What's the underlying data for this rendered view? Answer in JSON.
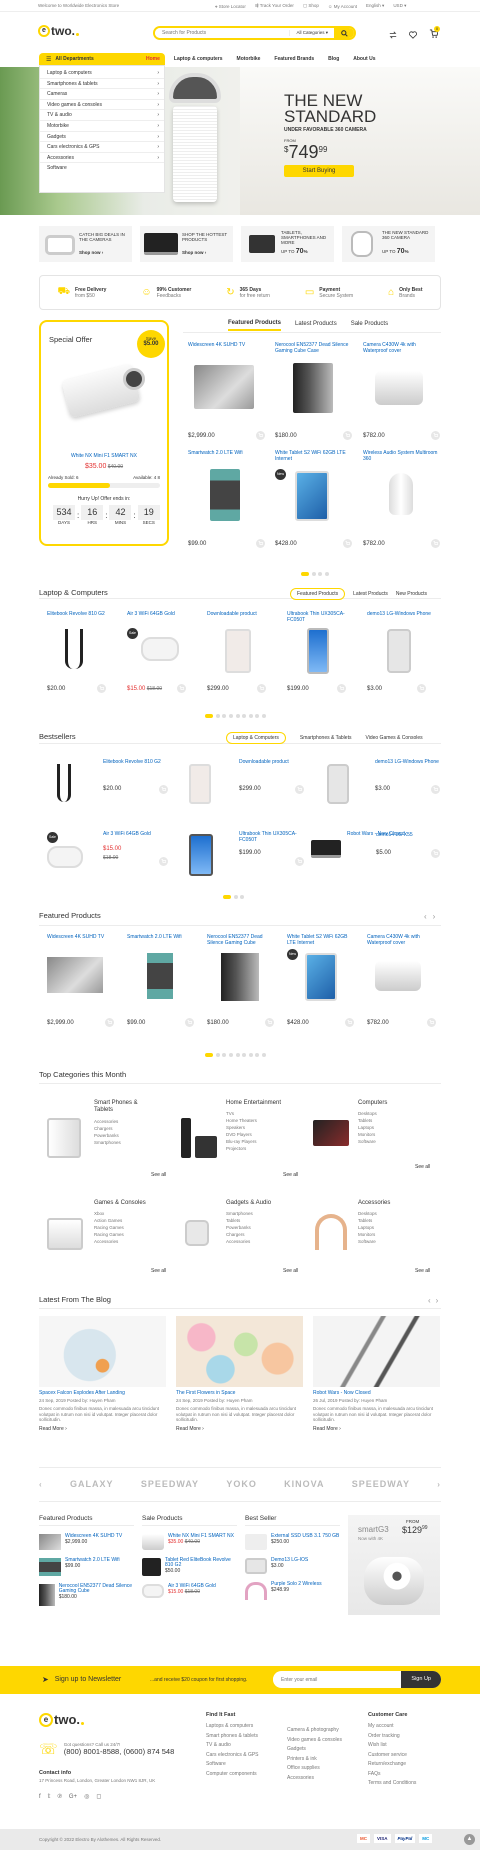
{
  "topbar": {
    "welcome": "Welcome to Worldwide Electronics Store",
    "links": [
      "Store Locator",
      "Track Your Order",
      "Shop",
      "My Account"
    ],
    "lang": "English",
    "currency": "USD"
  },
  "header": {
    "logo": "electro",
    "search_placeholder": "Search for Products",
    "category_select": "All Categories",
    "cart_count": "0"
  },
  "nav": [
    "Home",
    "Laptop & computers",
    "Motorbike",
    "Featured Brands",
    "Blog",
    "About Us"
  ],
  "sidebar": {
    "title": "All Departments",
    "items": [
      "Laptop & computers",
      "Smartphones & tablets",
      "Cameras",
      "Video games & consoles",
      "TV & audio",
      "Motorbike",
      "Gadgets",
      "Cars electronics & GPS",
      "Accessories",
      "Software"
    ]
  },
  "hero": {
    "line1": "THE NEW",
    "line2": "STANDARD",
    "sub": "UNDER FAVORABLE 360 CAMERA",
    "from": "FROM",
    "price": "749",
    "cents": "99",
    "cta": "Start Buying"
  },
  "promo_banners": [
    {
      "text": "CATCH BIG DEALS IN THE CAMERAS",
      "link": "Shop now"
    },
    {
      "text": "SHOP THE HOTTEST PRODUCTS",
      "link": "Shop now"
    },
    {
      "text": "TABLETS, SMARTPHONES AND MORE",
      "upto": "UP TO",
      "pct": "70"
    },
    {
      "text": "THE NEW STANDARD 360 CAMERA",
      "upto": "UP TO",
      "pct": "70"
    }
  ],
  "features": [
    {
      "title": "Free Delivery",
      "sub": "from $50"
    },
    {
      "title": "99% Customer",
      "sub": "Feedbacks"
    },
    {
      "title": "365 Days",
      "sub": "for free return"
    },
    {
      "title": "Payment",
      "sub": "Secure System"
    },
    {
      "title": "Only Best",
      "sub": "Brands"
    }
  ],
  "special_offer": {
    "title": "Special Offer",
    "save_label": "Save",
    "save_amount": "$5.00",
    "product": "White NX Mini F1 SMART NX",
    "price": "$35.00",
    "old_price": "$40.00",
    "sold_label": "Already Sold: 6",
    "available_label": "Available: 4 8",
    "timer_label": "Hurry Up! Offer ends in:",
    "timer": [
      {
        "v": "534",
        "l": "DAYS"
      },
      {
        "v": "16",
        "l": "HRS"
      },
      {
        "v": "42",
        "l": "MINS"
      },
      {
        "v": "19",
        "l": "SECS"
      }
    ]
  },
  "featured_tabs": [
    "Featured Products",
    "Latest Products",
    "Sale Products"
  ],
  "featured_grid": [
    {
      "name": "Widescreen 4K SUHD TV",
      "price": "$2,999.00"
    },
    {
      "name": "Nerocool EN52377 Dead Silence Gaming Cube Case",
      "price": "$180.00"
    },
    {
      "name": "Camera C430W 4k with Waterproof cover",
      "price": "$782.00"
    },
    {
      "name": "Smartwatch 2.0 LTE Wifi",
      "price": "$99.00"
    },
    {
      "name": "White Tablet S2 WiFi 62GB LTE Internet",
      "price": "$428.00",
      "badge": "New"
    },
    {
      "name": "Wireless Audio System Multiroom 360",
      "price": "$782.00"
    }
  ],
  "laptops_section": {
    "title": "Laptop & Computers",
    "tabs": [
      "Featured Products",
      "Latest Products",
      "New Products"
    ],
    "products": [
      {
        "name": "Elitebook Revolve 810 G2",
        "price": "$20.00"
      },
      {
        "name": "Air 3 WiFi 64GB Gold",
        "price": "$15.00",
        "old": "$18.00",
        "badge": "Sale"
      },
      {
        "name": "Downloadable product",
        "price": "$299.00"
      },
      {
        "name": "Ultrabook Thin UX305CA-FC050T",
        "price": "$199.00"
      },
      {
        "name": "demo13 LG-Windows Phone",
        "price": "$3.00"
      }
    ]
  },
  "bestsellers": {
    "title": "Bestsellers",
    "tabs": [
      "Laptop & Computers",
      "Smartphones & Tablets",
      "Video Games & Consoles"
    ],
    "products": [
      {
        "name": "Elitebook Revolve 810 G2",
        "price": "$20.00"
      },
      {
        "name": "Downloadable product",
        "price": "$299.00"
      },
      {
        "name": "demo13 LG-Windows Phone",
        "price": "$3.00"
      },
      {
        "name": "Air 3 WiFi 64GB Gold",
        "price": "$15.00",
        "old": "$18.00",
        "badge": "Sale"
      },
      {
        "name": "Ultrabook Thin UX305CA-FC050T",
        "price": "$199.00"
      },
      {
        "name": "Robot Wars - Now Closed",
        "price": "$5.00"
      },
      {
        "name": "demo14 LG-X55",
        "price": "$5.00"
      }
    ]
  },
  "featured_row": {
    "title": "Featured Products",
    "products": [
      {
        "name": "Widescreen 4K SUHD TV",
        "price": "$2,999.00"
      },
      {
        "name": "Smartwatch 2.0 LTE Wifi",
        "price": "$99.00"
      },
      {
        "name": "Nerocool EN52377 Dead Silence Gaming Cube",
        "price": "$180.00"
      },
      {
        "name": "White Tablet S2 WiFi 62GB LTE Internet",
        "price": "$428.00",
        "badge": "New"
      },
      {
        "name": "Camera C430W 4k with Waterproof cover",
        "price": "$782.00"
      }
    ]
  },
  "top_categories": {
    "title": "Top Categories this Month",
    "see_all": "See all",
    "items": [
      {
        "name": "Smart Phones & Tablets",
        "subs": [
          "Accessories",
          "Chargers",
          "Powerbanks",
          "Smartphones"
        ]
      },
      {
        "name": "Home Entertainment",
        "subs": [
          "TVs",
          "Home Theaters",
          "Speakers",
          "DVD Players",
          "Blu-ray Players",
          "Projectors"
        ]
      },
      {
        "name": "Computers",
        "subs": [
          "Desktops",
          "Tablets",
          "Laptops",
          "Monitors",
          "Software"
        ]
      },
      {
        "name": "Games & Consoles",
        "subs": [
          "Xbox",
          "Action Games",
          "Racing Games",
          "Racing Games",
          "Accessories"
        ]
      },
      {
        "name": "Gadgets & Audio",
        "subs": [
          "Smartphones",
          "Tablets",
          "Powerbanks",
          "Chargers",
          "Accessories"
        ]
      },
      {
        "name": "Accessories",
        "subs": [
          "Desktops",
          "Tablets",
          "Laptops",
          "Monitors",
          "Software"
        ]
      }
    ]
  },
  "blog": {
    "title": "Latest From The Blog",
    "read_more": "Read More",
    "excerpt": "Donec commodo finibus massa, in malesuada arcu tincidunt volutpat in rutrum non nisi id volutpat. Integer placerat dolor sollicitudin.",
    "posts": [
      {
        "title": "Spacex Falcon Explodes After Landing",
        "meta": "24 Sep, 2019  Posted by: Huyen Pham"
      },
      {
        "title": "The First Flowers in Space",
        "meta": "24 Sep, 2019  Posted by: Huyen Pham"
      },
      {
        "title": "Robot Wars - Now Closed",
        "meta": "26 Jul, 2019  Posted by: Huyen Pham"
      }
    ]
  },
  "brands": [
    "GALAXY",
    "SPEEDWAY",
    "YOKO",
    "KINOVA",
    "SPEEDWAY"
  ],
  "lists": [
    {
      "title": "Featured Products",
      "items": [
        {
          "name": "Widescreen 4K SUHD TV",
          "price": "$2,999.00"
        },
        {
          "name": "Smartwatch 2.0 LTE Wifi",
          "price": "$99.00"
        },
        {
          "name": "Nerocool EN52377 Dead Silence Gaming Cube",
          "price": "$180.00"
        }
      ]
    },
    {
      "title": "Sale Products",
      "items": [
        {
          "name": "White NX Mini F1 SMART NX",
          "price": "$35.00",
          "old": "$40.00"
        },
        {
          "name": "Tablet Red EliteBook Revolve 810 G2",
          "price": "$50.00"
        },
        {
          "name": "Air 3 WiFi 64GB Gold",
          "price": "$15.00",
          "old": "$18.00"
        }
      ]
    },
    {
      "title": "Best Seller",
      "items": [
        {
          "name": "External SSD USB 3.1 750 GB",
          "price": "$250.00"
        },
        {
          "name": "Demo13 LG-IOS",
          "price": "$3.00"
        },
        {
          "name": "Purple Solo 2 Wireless",
          "price": "$248.99"
        }
      ]
    }
  ],
  "side_ad": {
    "brand": "smartG3",
    "sub": "Now with 4K",
    "from": "FROM",
    "price": "$129",
    "cents": "99"
  },
  "newsletter": {
    "label": "Sign up to Newsletter",
    "offer": "...and receive $20 coupon for first shopping.",
    "placeholder": "Enter your email",
    "button": "Sign Up"
  },
  "footer": {
    "logo": "electro",
    "support_q": "Got questions? Call us 24/7!",
    "phones": "(800) 8001-8588, (0600) 874 548",
    "contact_title": "Contact info",
    "address": "17 Princess Road, London, Greater London NW1 8JR, UK",
    "find_title": "Find It Fast",
    "col1": [
      "Laptops & computers",
      "Smart phones & tablets",
      "TV & audio",
      "Cars electronics & GPS",
      "Software",
      "Computer components"
    ],
    "col2": [
      "Camera & photography",
      "Video games & consoles",
      "Gadgets",
      "Printers & ink",
      "Office supplies",
      "Accessories"
    ],
    "care_title": "Customer Care",
    "col3": [
      "My account",
      "Order tracking",
      "Wish list",
      "Customer service",
      "Return/exchange",
      "FAQs",
      "Terms and Conditions"
    ],
    "copyright": "Copyright © 2022 Electro By Alothemes. All Rights Reserved.",
    "payments": [
      "MC",
      "VISA",
      "PayPal",
      "MC"
    ]
  },
  "colors": {
    "accent": "#fed700",
    "link": "#0062bd",
    "sale": "#e32f2f"
  }
}
